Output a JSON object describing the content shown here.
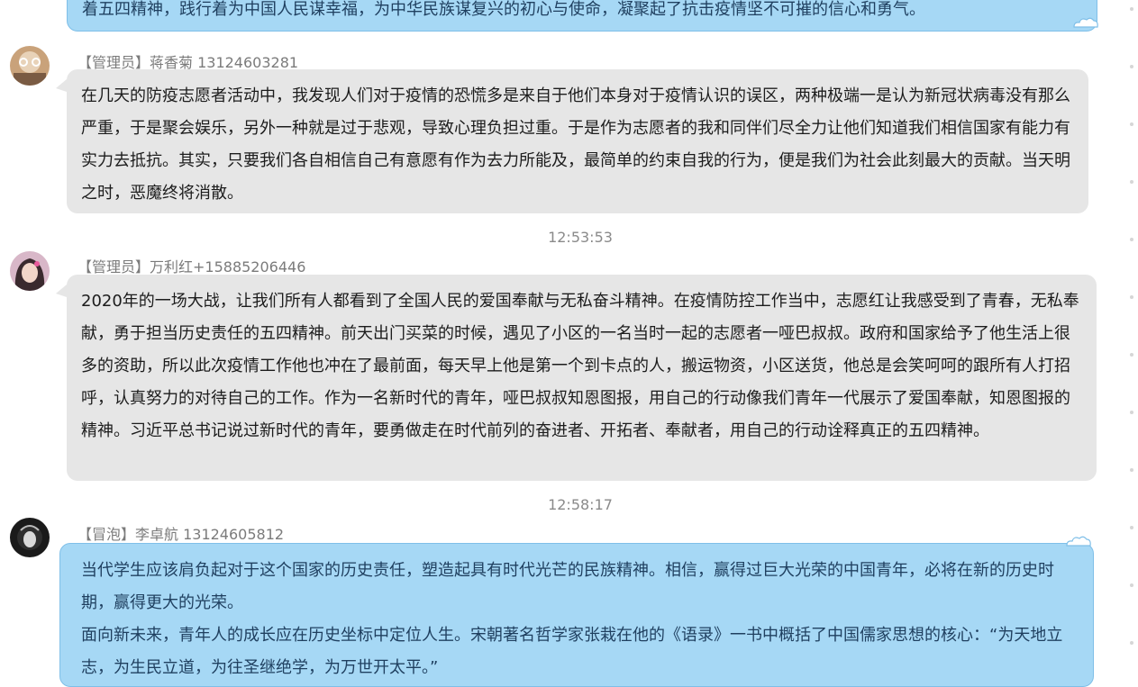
{
  "messages": [
    {
      "id": "m0",
      "text": "着五四精神，践行着为中国人民谋幸福，为中华民族谋复兴的初心与使命，凝聚起了抗击疫情坚不可摧的信心和勇气。"
    },
    {
      "id": "m1",
      "sender": "【管理员】蒋香菊 13124603281",
      "text": "在几天的防疫志愿者活动中，我发现人们对于疫情的恐慌多是来自于他们本身对于疫情认识的误区，两种极端一是认为新冠状病毒没有那么严重，于是聚会娱乐，另外一种就是过于悲观，导致心理负担过重。于是作为志愿者的我和同伴们尽全力让他们知道我们相信国家有能力有实力去抵抗。其实，只要我们各自相信自己有意愿有作为去力所能及，最简单的约束自我的行为，便是我们为社会此刻最大的贡献。当天明之时，恶魔终将消散。"
    },
    {
      "id": "m2",
      "timestamp": "12:53:53",
      "sender": "【管理员】万利红+15885206446",
      "text": "2020年的一场大战，让我们所有人都看到了全国人民的爱国奉献与无私奋斗精神。在疫情防控工作当中，志愿红让我感受到了青春，无私奉献，勇于担当历史责任的五四精神。前天出门买菜的时候，遇见了小区的一名当时一起的志愿者一哑巴叔叔。政府和国家给予了他生活上很多的资助，所以此次疫情工作他也冲在了最前面，每天早上他是第一个到卡点的人，搬运物资，小区送货，他总是会笑呵呵的跟所有人打招呼，认真努力的对待自己的工作。作为一名新时代的青年，哑巴叔叔知恩图报，用自己的行动像我们青年一代展示了爱国奉献，知恩图报的精神。习近平总书记说过新时代的青年，要勇做走在时代前列的奋进者、开拓者、奉献者，用自己的行动诠释真正的五四精神。"
    },
    {
      "id": "m3",
      "timestamp": "12:58:17",
      "sender": "【冒泡】李卓航 13124605812",
      "text_p1": "当代学生应该肩负起对于这个国家的历史责任，塑造起具有时代光芒的民族精神。相信，赢得过巨大光荣的中国青年，必将在新的历史时期，赢得更大的光荣。",
      "text_p2": "面向新未来，青年人的成长应在历史坐标中定位人生。宋朝著名哲学家张栽在他的《语录》一书中概括了中国儒家思想的核心：“为天地立志，为生民立道，为往圣继绝学，为万世开太平。”"
    }
  ],
  "colors": {
    "gray_bubble": "#e6e6e6",
    "blue_bubble": "#a6d8f5",
    "sender_text": "#7b7b7b"
  }
}
